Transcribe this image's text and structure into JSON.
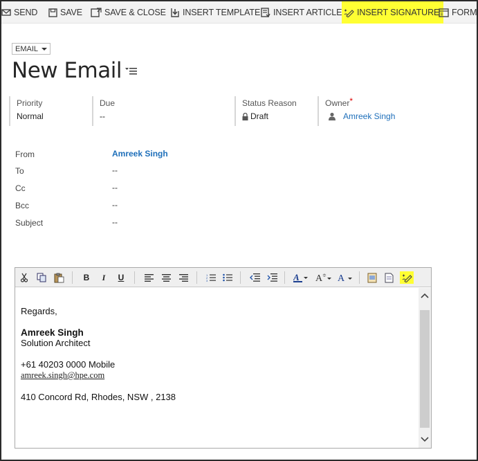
{
  "commandbar": {
    "send": "SEND",
    "save": "SAVE",
    "save_close": "SAVE & CLOSE",
    "insert_template": "INSERT TEMPLATE",
    "insert_article": "INSERT ARTICLE",
    "insert_signature": "INSERT SIGNATURE",
    "form": "FORM"
  },
  "header": {
    "record_type": "EMAIL",
    "title": "New Email",
    "fields": {
      "priority_label": "Priority",
      "priority_value": "Normal",
      "due_label": "Due",
      "due_value": "--",
      "status_label": "Status Reason",
      "status_value": "Draft",
      "owner_label": "Owner",
      "owner_required": "*",
      "owner_value": "Amreek Singh"
    }
  },
  "form": {
    "from_label": "From",
    "from_value": "Amreek Singh",
    "to_label": "To",
    "to_value": "--",
    "cc_label": "Cc",
    "cc_value": "--",
    "bcc_label": "Bcc",
    "bcc_value": "--",
    "subject_label": "Subject",
    "subject_value": "--"
  },
  "editor": {
    "toolbar": {
      "bold": "B",
      "italic": "I",
      "underline": "U"
    },
    "body": {
      "greeting": "Regards,",
      "name": "Amreek Singh",
      "role": "Solution Architect",
      "phone": "+61 40203 0000  Mobile",
      "email": "amreek.singh@hpe.com",
      "address": "410 Concord Rd, Rhodes, NSW , 2138"
    }
  },
  "colors": {
    "highlight": "#ffff33",
    "link": "#1e6fba",
    "required": "#dd0000"
  }
}
